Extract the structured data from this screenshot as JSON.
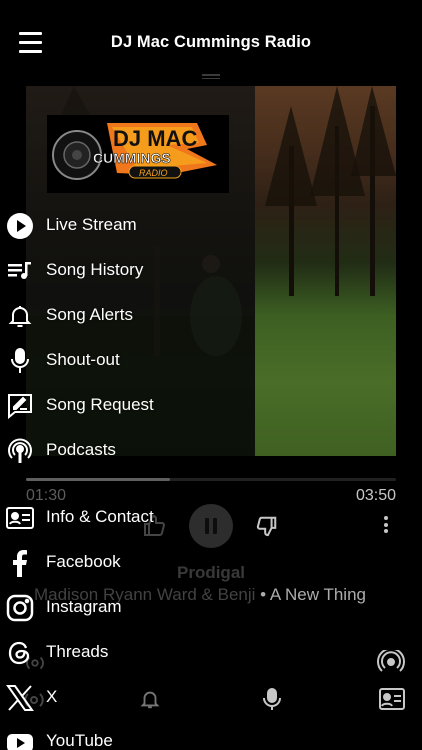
{
  "header": {
    "title": "DJ Mac Cummings Radio",
    "menu_icon": "hamburger-menu-icon"
  },
  "logo": {
    "line1": "DJ MAC",
    "line2": "CUMMINGS",
    "line3": "RADIO"
  },
  "drawer": {
    "items": [
      {
        "label": "Live Stream",
        "icon": "play-circle-icon"
      },
      {
        "label": "Song History",
        "icon": "playlist-icon"
      },
      {
        "label": "Song Alerts",
        "icon": "bell-icon"
      },
      {
        "label": "Shout-out",
        "icon": "microphone-icon"
      },
      {
        "label": "Song Request",
        "icon": "compose-icon"
      },
      {
        "label": "Podcasts",
        "icon": "podcast-icon"
      },
      {
        "label": "Info & Contact",
        "icon": "contact-card-icon"
      },
      {
        "label": "Facebook",
        "icon": "facebook-icon"
      },
      {
        "label": "Instagram",
        "icon": "instagram-icon"
      },
      {
        "label": "Threads",
        "icon": "threads-icon"
      },
      {
        "label": "X",
        "icon": "x-icon"
      },
      {
        "label": "YouTube",
        "icon": "youtube-icon"
      }
    ]
  },
  "player": {
    "elapsed": "01:30",
    "total": "03:50",
    "progress": 0.39,
    "song_title": "Prodigal",
    "artist": "Madison Ryann Ward & Benji",
    "separator": "•",
    "album": "A New Thing"
  },
  "colors": {
    "background": "#000000",
    "text": "#ffffff",
    "muted": "#777777"
  }
}
